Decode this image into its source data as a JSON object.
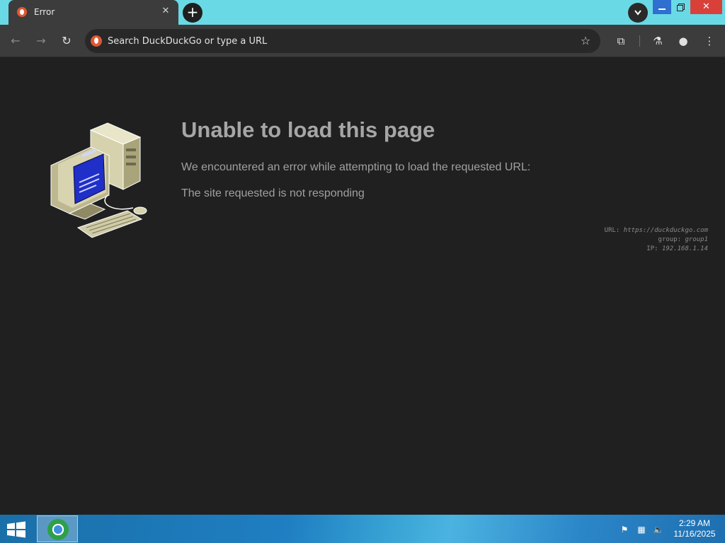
{
  "browser": {
    "tab": {
      "title": "Error",
      "close_glyph": "✕"
    },
    "new_tab_glyph": "+",
    "window_close_glyph": "✕",
    "toolbar": {
      "back_glyph": "←",
      "forward_glyph": "→",
      "reload_glyph": "↻",
      "omnibox_placeholder": "Search DuckDuckGo or type a URL",
      "star_glyph": "☆",
      "extensions_glyph": "⧉",
      "labs_glyph": "⚗",
      "profile_glyph": "●",
      "menu_glyph": "⋮"
    }
  },
  "page": {
    "title": "Unable to load this page",
    "message": "We encountered an error while attempting to load the requested URL:",
    "reason": "The site requested is not responding",
    "details": {
      "url_label": "URL:",
      "url_value": "https://duckduckgo.com",
      "group_label": "group:",
      "group_value": "group1",
      "ip_label": "IP:",
      "ip_value": "192.168.1.14"
    }
  },
  "taskbar": {
    "clock_time": "2:29 AM",
    "clock_date": "11/16/2025",
    "tray_flag_glyph": "⚑",
    "tray_network_glyph": "▦",
    "tray_volume_glyph": "🔈"
  },
  "colors": {
    "titlebar": "#6ad9e6",
    "tab_active": "#3c3c3c",
    "page_background": "#202020",
    "duckduckgo_brand": "#de5833",
    "window_close": "#d9403a"
  },
  "icons": [
    "duckduckgo-icon",
    "close-icon",
    "plus-icon",
    "chevron-down-icon",
    "back-arrow-icon",
    "forward-arrow-icon",
    "reload-icon",
    "star-icon",
    "puzzle-icon",
    "flask-icon",
    "person-icon",
    "kebab-menu-icon",
    "computer-illustration",
    "windows-logo-icon",
    "chrome-logo-icon",
    "flag-icon",
    "network-icon",
    "volume-muted-icon"
  ]
}
